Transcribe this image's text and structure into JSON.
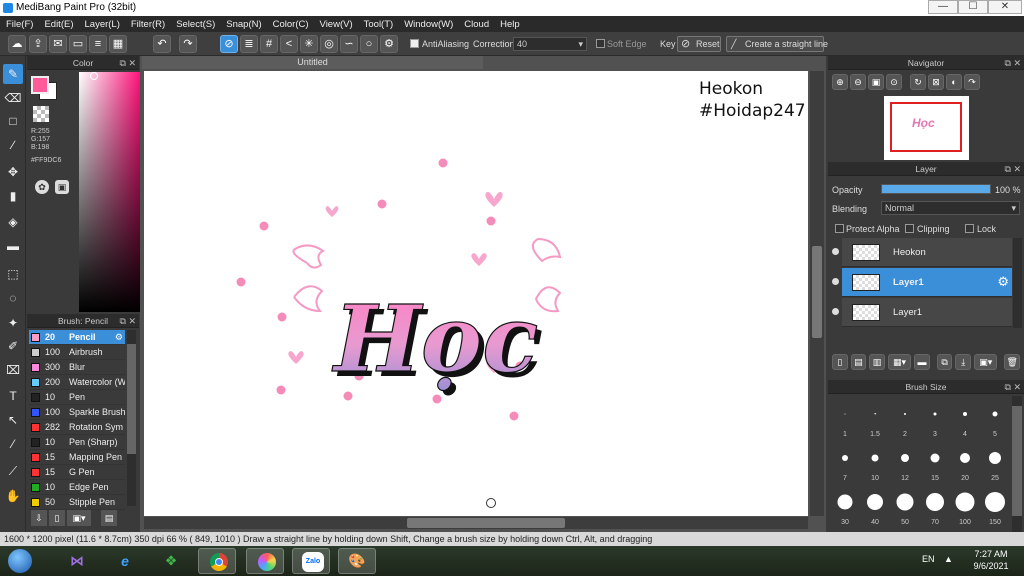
{
  "window": {
    "title": "MediBang Paint Pro (32bit)",
    "min": "—",
    "max": "☐",
    "close": "✕"
  },
  "menu": [
    "File(F)",
    "Edit(E)",
    "Layer(L)",
    "Filter(R)",
    "Select(S)",
    "Snap(N)",
    "Color(C)",
    "View(V)",
    "Tool(T)",
    "Window(W)",
    "Cloud",
    "Help"
  ],
  "toolbar": {
    "antialiasing_label": "AntiAliasing",
    "correction_label": "Correction",
    "correction_value": "40",
    "soft_edge_label": "Soft Edge",
    "key_label": "Key",
    "reset_label": "Reset",
    "straight_line_label": "Create a straight line"
  },
  "color_panel": {
    "title": "Color",
    "r": "R:255",
    "g": "G:157",
    "b": "B:198",
    "hex": "#FF9DC6",
    "fg_color": "#ff9dc6",
    "bg_color": "#ffffff"
  },
  "brush_panel": {
    "title": "Brush: Pencil",
    "brushes": [
      {
        "size": "20",
        "name": "Pencil",
        "color": "#ff9dc6"
      },
      {
        "size": "100",
        "name": "Airbrush",
        "color": "#cccccc"
      },
      {
        "size": "300",
        "name": "Blur",
        "color": "#ff88dd"
      },
      {
        "size": "200",
        "name": "Watercolor (W",
        "color": "#66ccff"
      },
      {
        "size": "10",
        "name": "Pen",
        "color": "#222222"
      },
      {
        "size": "100",
        "name": "Sparkle Brush",
        "color": "#3355ff"
      },
      {
        "size": "282",
        "name": "Rotation Sym",
        "color": "#ff3333"
      },
      {
        "size": "10",
        "name": "Pen (Sharp)",
        "color": "#222222"
      },
      {
        "size": "15",
        "name": "Mapping Pen",
        "color": "#ff3333"
      },
      {
        "size": "15",
        "name": "G Pen",
        "color": "#ff3333"
      },
      {
        "size": "10",
        "name": "Edge Pen",
        "color": "#22aa22"
      },
      {
        "size": "50",
        "name": "Stipple Pen",
        "color": "#eecc00"
      }
    ]
  },
  "document": {
    "tab_title": "Untitled",
    "watermark_line1": "Heokon",
    "watermark_line2": "#Hoidap247",
    "artwork_text": "Học"
  },
  "navigator": {
    "title": "Navigator"
  },
  "layer_panel": {
    "title": "Layer",
    "opacity_label": "Opacity",
    "opacity_value": "100 %",
    "opacity_fraction": 1.0,
    "blending_label": "Blending",
    "blending_value": "Normal",
    "protect_alpha": "Protect Alpha",
    "clipping": "Clipping",
    "lock": "Lock",
    "layers": [
      {
        "name": "Heokon",
        "selected": false
      },
      {
        "name": "Layer1",
        "selected": true
      },
      {
        "name": "Layer1",
        "selected": false
      }
    ]
  },
  "brush_size_panel": {
    "title": "Brush Size",
    "sizes": [
      "1",
      "1.5",
      "2",
      "3",
      "4",
      "5",
      "7",
      "10",
      "12",
      "15",
      "20",
      "25",
      "30",
      "40",
      "50",
      "70",
      "100",
      "150"
    ]
  },
  "status": {
    "text": "1600 * 1200 pixel   (11.6 * 8.7cm)   350 dpi   66 %   ( 849, 1010 )   Draw a straight line by holding down Shift, Change a brush size by holding down Ctrl, Alt, and dragging"
  },
  "taskbar": {
    "lang": "EN",
    "time": "7:27 AM",
    "date": "9/6/2021",
    "zalo_label": "Zalo"
  }
}
